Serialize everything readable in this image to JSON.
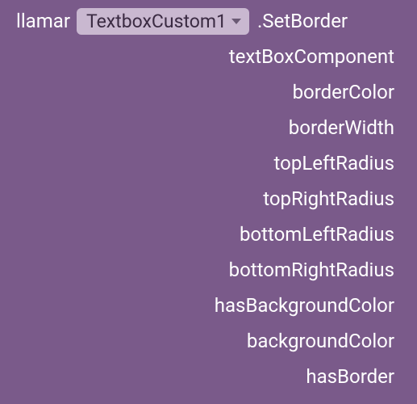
{
  "block": {
    "call_keyword": "llamar",
    "component_dropdown": {
      "selected": "TextboxCustom1"
    },
    "method_name": ".SetBorder",
    "params": [
      "textBoxComponent",
      "borderColor",
      "borderWidth",
      "topLeftRadius",
      "topRightRadius",
      "bottomLeftRadius",
      "bottomRightRadius",
      "hasBackgroundColor",
      "backgroundColor",
      "hasBorder"
    ]
  }
}
